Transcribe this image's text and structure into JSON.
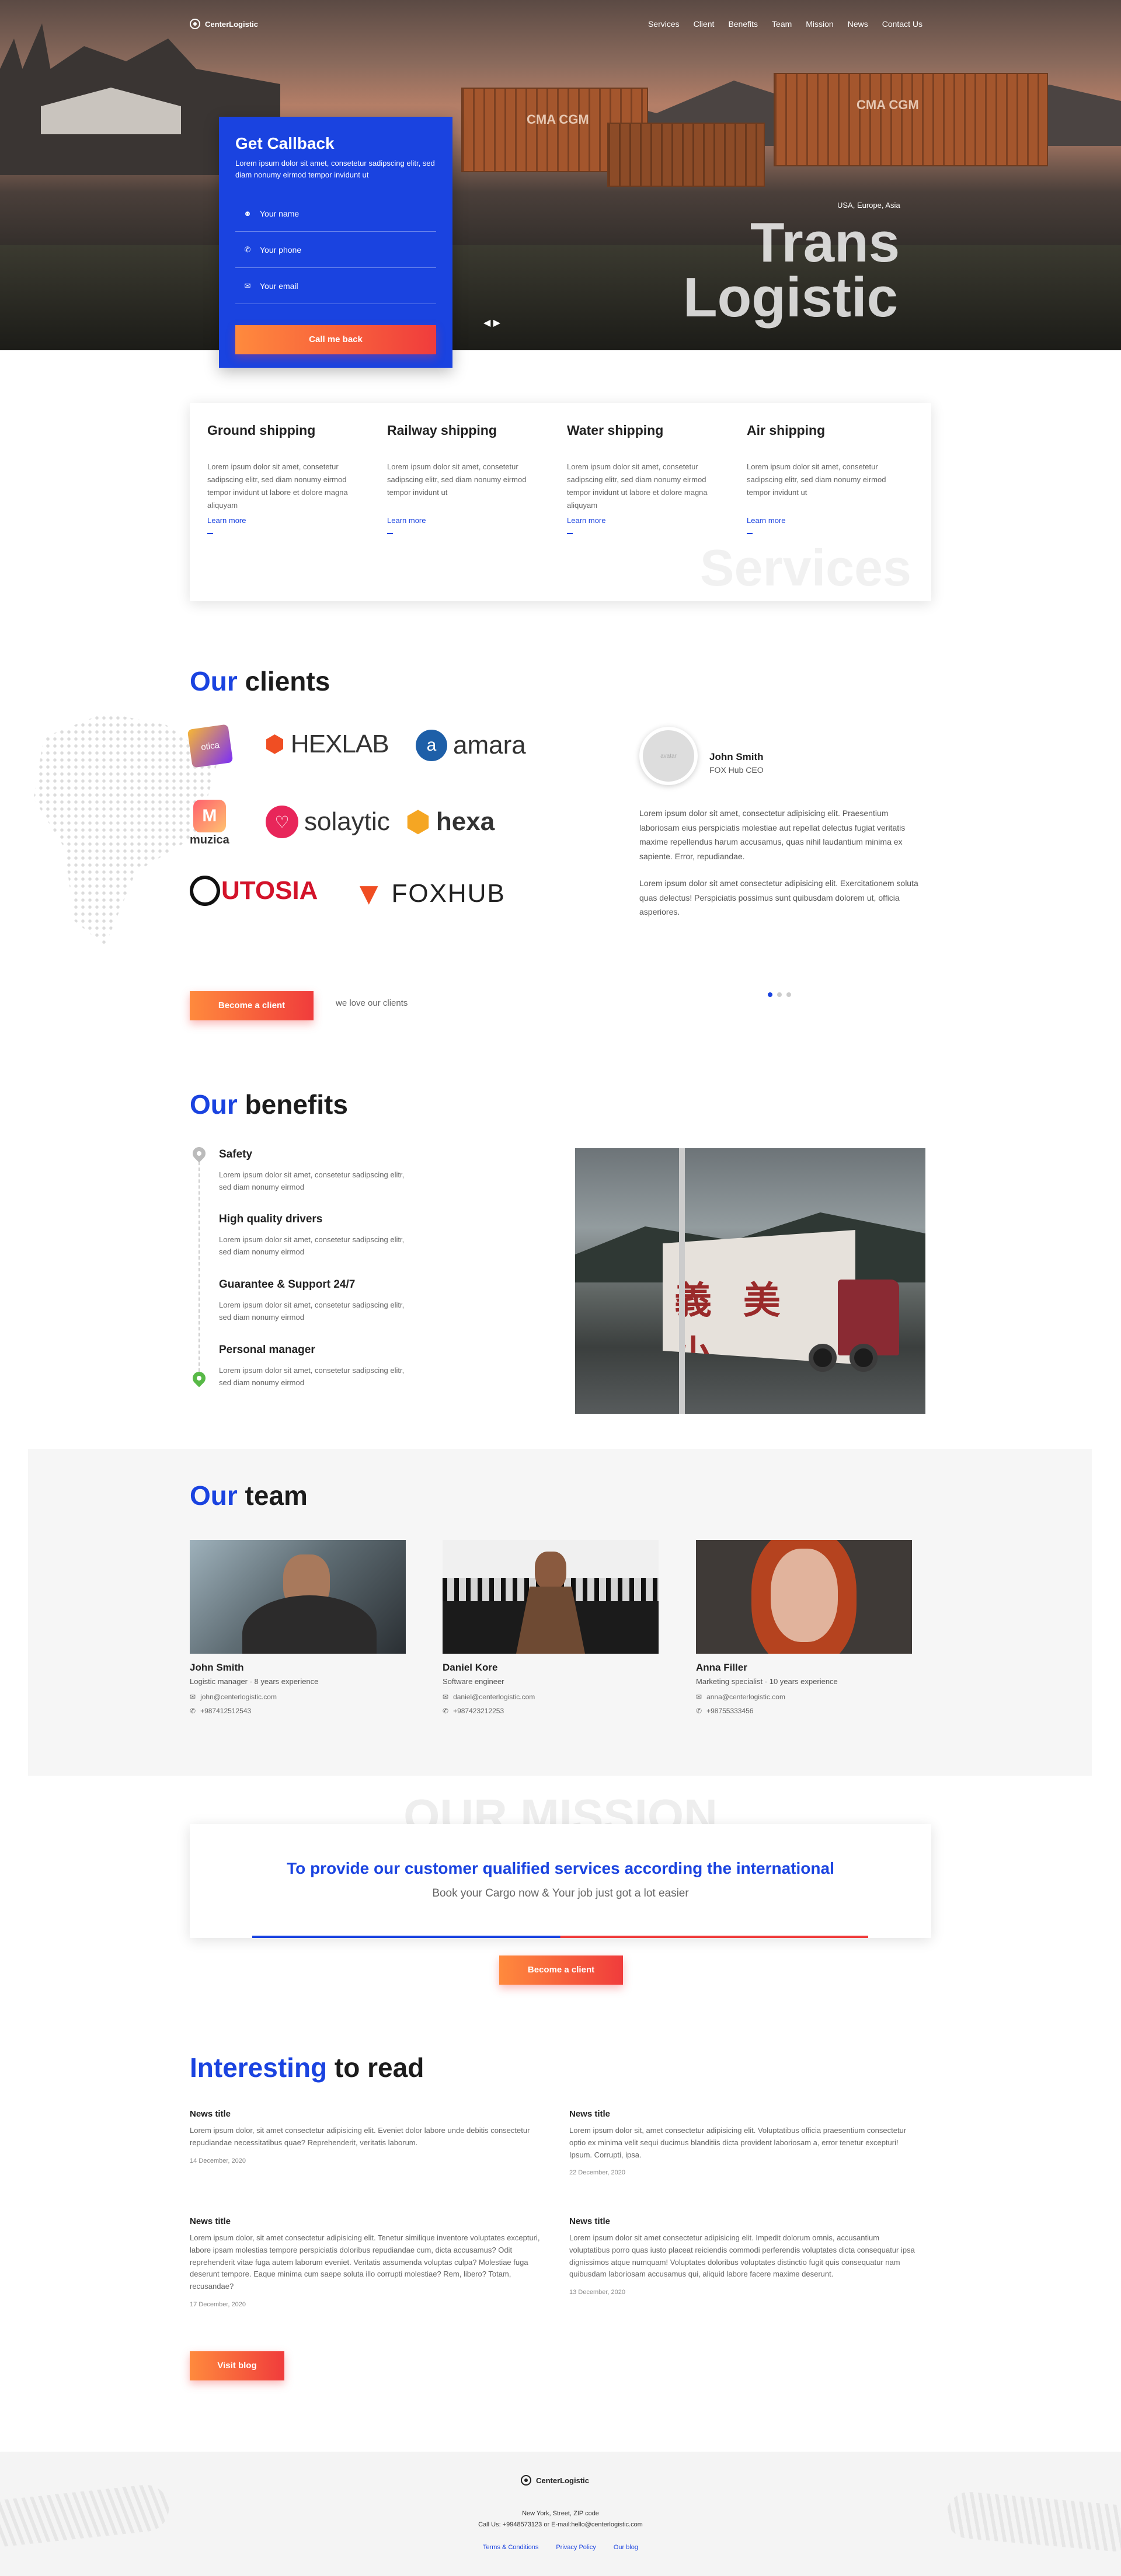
{
  "header": {
    "brand": "CenterLogistic",
    "nav": [
      "Services",
      "Client",
      "Benefits",
      "Team",
      "Mission",
      "News",
      "Contact Us"
    ]
  },
  "hero": {
    "subtitle": "USA, Europe, Asia",
    "title_line1": "Trans",
    "title_line2": "Logistic",
    "container_label_1": "CMA CGM",
    "container_label_2": "CMA CGM",
    "arrows": "◀ ▶"
  },
  "callback": {
    "title": "Get Callback",
    "text": "Lorem ipsum dolor sit amet, consetetur sadipscing elitr, sed diam nonumy eirmod tempor invidunt ut",
    "fields": [
      {
        "label": "Your name",
        "icon": "user-icon"
      },
      {
        "label": "Your phone",
        "icon": "phone-icon"
      },
      {
        "label": "Your email",
        "icon": "mail-icon"
      }
    ],
    "button": "Call me back"
  },
  "services": {
    "watermark": "Services",
    "items": [
      {
        "title": "Ground shipping",
        "text": "Lorem ipsum dolor sit amet, consetetur sadipscing elitr, sed diam nonumy eirmod tempor invidunt ut labore et dolore magna aliquyam",
        "link": "Learn more"
      },
      {
        "title": "Railway shipping",
        "text": "Lorem ipsum dolor sit amet, consetetur sadipscing elitr, sed diam nonumy eirmod tempor invidunt ut",
        "link": "Learn more"
      },
      {
        "title": "Water shipping",
        "text": "Lorem ipsum dolor sit amet, consetetur sadipscing elitr, sed diam nonumy eirmod tempor invidunt ut labore et dolore magna aliquyam",
        "link": "Learn more"
      },
      {
        "title": "Air shipping",
        "text": "Lorem ipsum dolor sit amet, consetetur sadipscing elitr, sed diam nonumy eirmod tempor invidunt ut",
        "link": "Learn more"
      }
    ]
  },
  "clients": {
    "title_hl": "Our",
    "title_rest": " clients",
    "logos": [
      "otica",
      "HEXLAB",
      "amara",
      "muzica",
      "solaytic",
      "hexa",
      "UTOSIA",
      "FOXHUB"
    ],
    "testimonial": {
      "avatar_text": "avatar",
      "name": "John Smith",
      "role": "FOX Hub CEO",
      "p1": "Lorem ipsum dolor sit amet, consectetur adipisicing elit. Praesentium laboriosam eius perspiciatis molestiae aut repellat delectus fugiat veritatis maxime repellendus harum accusamus, quas nihil laudantium minima ex sapiente. Error, repudiandae.",
      "p2": "Lorem ipsum dolor sit amet consectetur adipisicing elit. Exercitationem soluta quas delectus! Perspiciatis possimus sunt quibusdam dolorem ut, officia asperiores."
    },
    "button": "Become a client",
    "tagline": "we love our clients"
  },
  "benefits": {
    "title_hl": "Our",
    "title_rest": " benefits",
    "items": [
      {
        "title": "Safety",
        "text": "Lorem ipsum dolor sit amet, consetetur sadipscing elitr, sed diam nonumy eirmod"
      },
      {
        "title": "High quality drivers",
        "text": "Lorem ipsum dolor sit amet, consetetur sadipscing elitr, sed diam nonumy eirmod"
      },
      {
        "title": "Guarantee & Support 24/7",
        "text": "Lorem ipsum dolor sit amet, consetetur sadipscing elitr, sed diam nonumy eirmod"
      },
      {
        "title": "Personal manager",
        "text": "Lorem ipsum dolor sit amet, consetetur sadipscing elitr, sed diam nonumy eirmod"
      }
    ],
    "truck_text": "義 美 小"
  },
  "team": {
    "title_hl": "Our",
    "title_rest": " team",
    "members": [
      {
        "name": "John Smith",
        "role": "Logistic manager - 8 years experience",
        "email": "john@centerlogistic.com",
        "phone": "+987412512543"
      },
      {
        "name": "Daniel Kore",
        "role": "Software engineer",
        "email": "daniel@centerlogistic.com",
        "phone": "+987423212253"
      },
      {
        "name": "Anna Filler",
        "role": "Marketing specialist - 10 years experience",
        "email": "anna@centerlogistic.com",
        "phone": "+98755333456"
      }
    ]
  },
  "mission": {
    "watermark": "OUR MISSION",
    "headline": "To provide our customer qualified services according the international",
    "sub": "Book your Cargo now & Your job just got a lot easier",
    "button": "Become a client"
  },
  "news": {
    "title_hl": "Interesting",
    "title_rest": " to read",
    "items": [
      {
        "title": "News title",
        "text": "Lorem ipsum dolor, sit amet consectetur adipisicing elit. Eveniet dolor labore unde debitis consectetur repudiandae necessitatibus quae? Reprehenderit, veritatis laborum.",
        "date": "14 December, 2020"
      },
      {
        "title": "News title",
        "text": "Lorem ipsum dolor sit, amet consectetur adipisicing elit. Voluptatibus officia praesentium consectetur optio ex minima velit sequi ducimus blanditiis dicta provident laboriosam a, error tenetur excepturi! Ipsum. Corrupti, ipsa.",
        "date": "22 December, 2020"
      },
      {
        "title": "News title",
        "text": "Lorem ipsum dolor, sit amet consectetur adipisicing elit. Tenetur similique inventore voluptates excepturi, labore ipsam molestias tempore perspiciatis doloribus repudiandae cum, dicta accusamus? Odit reprehenderit vitae fuga autem laborum eveniet. Veritatis assumenda voluptas culpa? Molestiae fuga deserunt tempore. Eaque minima cum saepe soluta illo corrupti molestiae? Rem, libero? Totam, recusandae?",
        "date": "17 December, 2020"
      },
      {
        "title": "News title",
        "text": "Lorem ipsum dolor sit amet consectetur adipisicing elit. Impedit dolorum omnis, accusantium voluptatibus porro quas iusto placeat reiciendis commodi perferendis voluptates dicta consequatur ipsa dignissimos atque numquam! Voluptates doloribus voluptates distinctio fugit quis consequatur nam quibusdam laboriosam accusamus qui, aliquid labore facere maxime deserunt.",
        "date": "13 December, 2020"
      }
    ],
    "button": "Visit blog"
  },
  "footer": {
    "brand": "CenterLogistic",
    "address": "New York, Street, ZIP code",
    "contact": "Call Us: +9948573123 or E-mail:hello@centerlogistic.com",
    "links": [
      "Terms & Conditions",
      "Privacy Policy",
      "Our blog"
    ]
  },
  "colors": {
    "accent": "#1a43e0",
    "orange": "#ff8a3d",
    "red": "#f03c3c"
  }
}
